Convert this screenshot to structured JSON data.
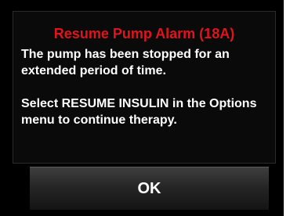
{
  "alarm": {
    "title": "Resume Pump Alarm (18A)",
    "message_line1": "The pump has been stopped for an extended period of time.",
    "message_line2": "Select RESUME INSULIN in the Options menu to continue therapy.",
    "title_color": "#e0141b"
  },
  "actions": {
    "ok_label": "OK"
  }
}
